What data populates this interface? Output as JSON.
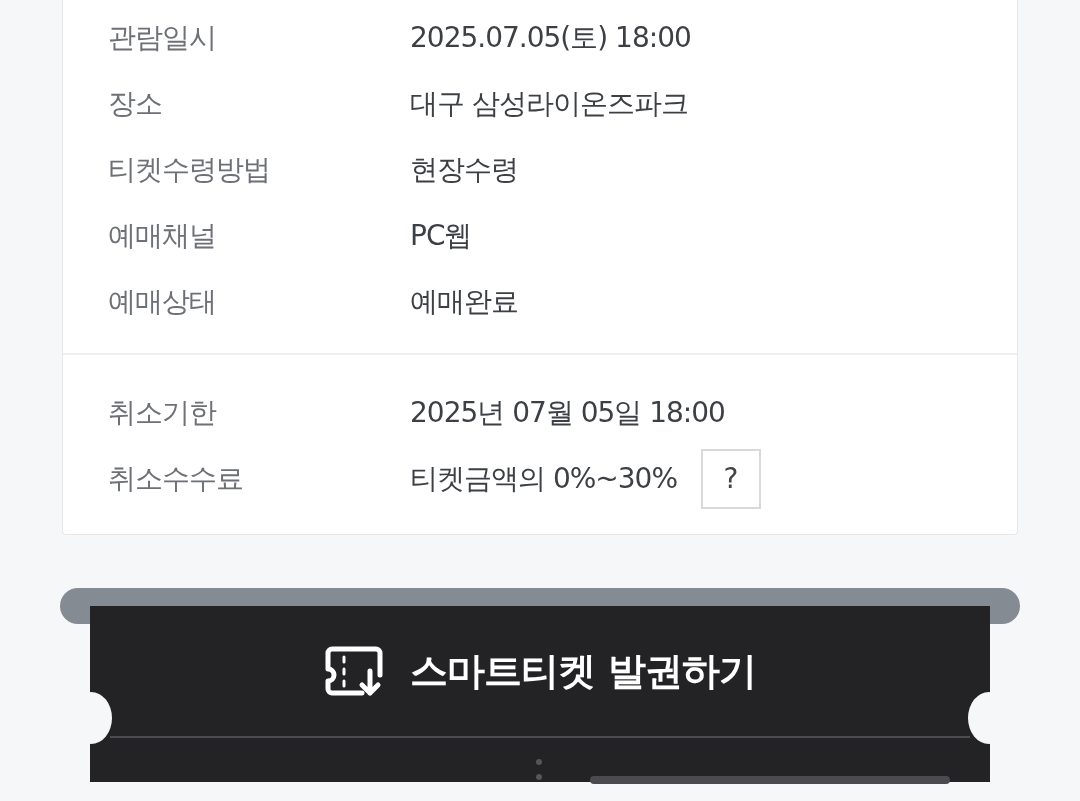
{
  "booking_details": [
    {
      "label": "관람일시",
      "value": "2025.07.05(토) 18:00"
    },
    {
      "label": "장소",
      "value": "대구 삼성라이온즈파크"
    },
    {
      "label": "티켓수령방법",
      "value": "현장수령"
    },
    {
      "label": "예매채널",
      "value": "PC웹"
    },
    {
      "label": "예매상태",
      "value": "예매완료"
    }
  ],
  "cancellation": [
    {
      "label": "취소기한",
      "value": "2025년 07월 05일 18:00"
    },
    {
      "label": "취소수수료",
      "value": "티켓금액의 0%~30%",
      "help_button": "?"
    }
  ],
  "smart_ticket": {
    "label": "스마트티켓 발권하기"
  }
}
